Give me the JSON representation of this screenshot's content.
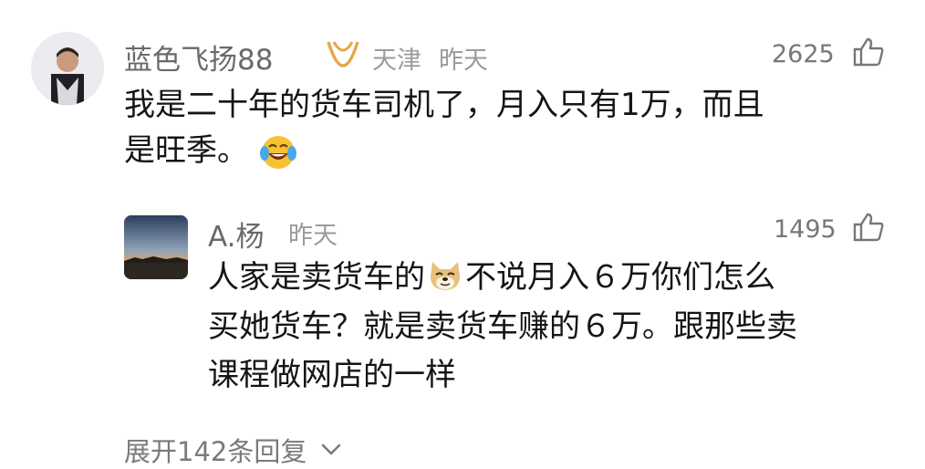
{
  "comment": {
    "username": "蓝色飞扬88",
    "location": "天津",
    "time": "昨天",
    "likes": "2625",
    "text_line1": "我是二十年的货车司机了，月入只有1万，而且",
    "text_line2": "是旺季。",
    "emoji": "laugh-cry-emoji"
  },
  "reply": {
    "username": "A.杨",
    "time": "昨天",
    "likes": "1495",
    "text_part1": "人家是卖货车的",
    "emoji": "doge-emoji",
    "text_part2": "不说月入６万你们怎么",
    "text_line2": "买她货车？就是卖货车赚的６万。跟那些卖",
    "text_line3": "课程做网店的一样"
  },
  "expand_label": "展开142条回复",
  "icons": {
    "badge": "vip-badge-icon",
    "like": "thumbs-up-icon",
    "expand": "chevron-down-icon"
  },
  "colors": {
    "badge": "#e8a64a",
    "text": "#151515",
    "meta": "#9b9b9b"
  }
}
